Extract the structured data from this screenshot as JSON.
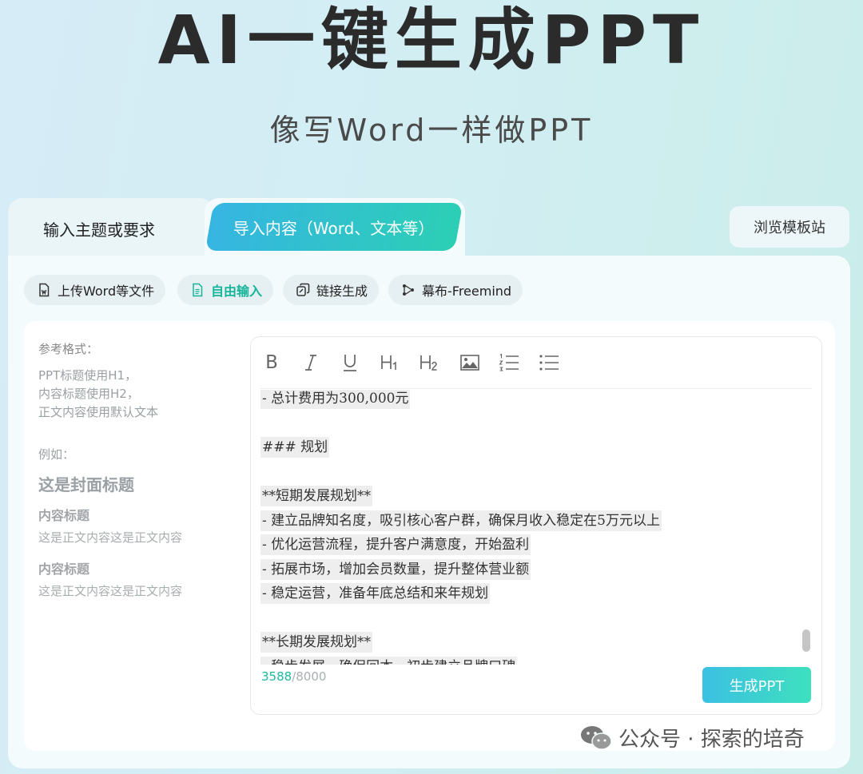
{
  "header": {
    "title": "AI一键生成PPT",
    "subtitle": "像写Word一样做PPT"
  },
  "tabs": [
    {
      "label": "输入主题或要求",
      "active": false
    },
    {
      "label": "导入内容（Word、文本等）",
      "active": true
    }
  ],
  "browse_button": "浏览模板站",
  "subtabs": [
    {
      "label": "上传Word等文件",
      "icon": "word-file-icon",
      "active": false
    },
    {
      "label": "自由输入",
      "icon": "document-icon",
      "active": true
    },
    {
      "label": "链接生成",
      "icon": "link-icon",
      "active": false
    },
    {
      "label": "幕布-Freemind",
      "icon": "mindmap-icon",
      "active": false
    }
  ],
  "reference": {
    "title": "参考格式：",
    "lines": [
      "PPT标题使用H1，",
      "内容标题使用H2，",
      "正文内容使用默认文本"
    ],
    "example_label": "例如：",
    "cover_title": "这是封面标题",
    "content_title_1": "内容标题",
    "body_1": "这是正文内容这是正文内容",
    "content_title_2": "内容标题",
    "body_2": "这是正文内容这是正文内容"
  },
  "toolbar": {
    "bold": "B",
    "italic": "I",
    "underline": "U",
    "h1": "H1",
    "h2": "H2",
    "tools": [
      "bold-icon",
      "italic-icon",
      "underline-icon",
      "heading1-icon",
      "heading2-icon",
      "image-icon",
      "ordered-list-icon",
      "bullet-list-icon"
    ]
  },
  "editor": {
    "lines": [
      "- 总计费用为300,000元",
      "",
      "### 规划",
      "",
      "**短期发展规划**",
      "- 建立品牌知名度，吸引核心客户群，确保月收入稳定在5万元以上",
      "- 优化运营流程，提升客户满意度，开始盈利",
      "- 拓展市场，增加会员数量，提升整体营业额",
      "- 稳定运营，准备年底总结和来年规划",
      "",
      "**长期发展规划**",
      "- 稳步发展，确保回本，初步建立品牌口碑"
    ],
    "char_count": "3588",
    "char_limit": "/8000"
  },
  "generate_button": "生成PPT",
  "watermark": "公众号 · 探索的培奇",
  "colors": {
    "accent_start": "#36b5e2",
    "accent_end": "#2ccfb5",
    "active_subtab": "#15b69a"
  }
}
